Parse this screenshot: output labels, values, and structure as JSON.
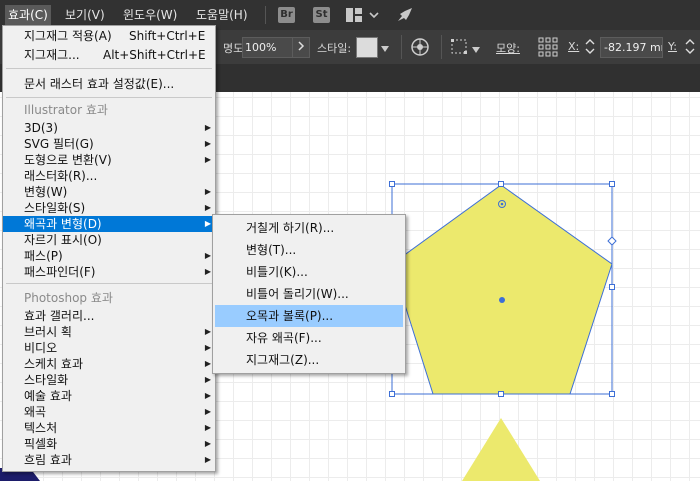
{
  "menubar": {
    "items": [
      {
        "label": "효과(C)",
        "active": true
      },
      {
        "label": "보기(V)"
      },
      {
        "label": "윈도우(W)"
      },
      {
        "label": "도움말(H)"
      }
    ],
    "bridge_label": "Br",
    "stock_label": "St"
  },
  "control_bar": {
    "opacity_label": "명도:",
    "opacity_value": "100%",
    "style_label": "스타일:",
    "shape_label": "모양:",
    "x_label": "X:",
    "x_value": "-82.197 mr",
    "y_label": "Y:"
  },
  "effect_menu": {
    "top_items": [
      {
        "label": "지그재그 적용(A)",
        "shortcut": "Shift+Ctrl+E"
      },
      {
        "label": "지그재그...",
        "shortcut": "Alt+Shift+Ctrl+E"
      }
    ],
    "raster_settings": "문서 래스터 효과 설정값(E)...",
    "illustrator_header": "Illustrator 효과",
    "illustrator_items": [
      {
        "label": "3D(3)",
        "submenu": true
      },
      {
        "label": "SVG 필터(G)",
        "submenu": true
      },
      {
        "label": "도형으로 변환(V)",
        "submenu": true
      },
      {
        "label": "래스터화(R)...",
        "submenu": false
      },
      {
        "label": "변형(W)",
        "submenu": true
      },
      {
        "label": "스타일화(S)",
        "submenu": true
      },
      {
        "label": "왜곡과 변형(D)",
        "submenu": true,
        "highlighted": true
      },
      {
        "label": "자르기 표시(O)",
        "submenu": false
      },
      {
        "label": "패스(P)",
        "submenu": true
      },
      {
        "label": "패스파인더(F)",
        "submenu": true
      }
    ],
    "photoshop_header": "Photoshop 효과",
    "photoshop_items": [
      {
        "label": "효과 갤러리...",
        "submenu": false
      },
      {
        "label": "브러시 획",
        "submenu": true
      },
      {
        "label": "비디오",
        "submenu": true
      },
      {
        "label": "스케치 효과",
        "submenu": true
      },
      {
        "label": "스타일화",
        "submenu": true
      },
      {
        "label": "예술 효과",
        "submenu": true
      },
      {
        "label": "왜곡",
        "submenu": true
      },
      {
        "label": "텍스처",
        "submenu": true
      },
      {
        "label": "픽셀화",
        "submenu": true
      },
      {
        "label": "흐림 효과",
        "submenu": true
      }
    ]
  },
  "distort_submenu": {
    "items": [
      {
        "label": "거칠게 하기(R)..."
      },
      {
        "label": "변형(T)..."
      },
      {
        "label": "비틀기(K)..."
      },
      {
        "label": "비틀어 돌리기(W)..."
      },
      {
        "label": "오목과 볼록(P)...",
        "highlighted": true
      },
      {
        "label": "자유 왜곡(F)..."
      },
      {
        "label": "지그재그(Z)..."
      }
    ]
  },
  "colors": {
    "shape_fill": "#ece96d",
    "selection": "#3d6fd6",
    "menu_highlight": "#0078d7",
    "submenu_highlight": "#99ccff"
  },
  "icons": [
    "bridge-icon",
    "stock-icon",
    "workspace-icon",
    "chevron-down-icon",
    "rocket-icon",
    "globe-icon",
    "transform-icon",
    "grid-icon"
  ]
}
